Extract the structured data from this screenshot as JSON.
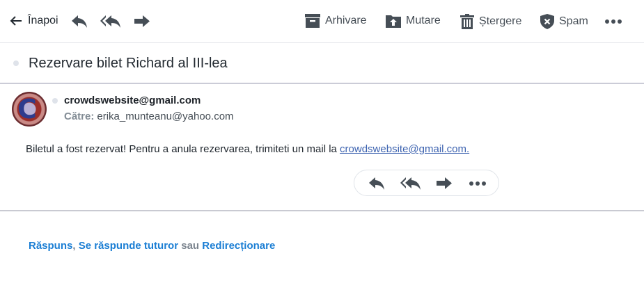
{
  "toolbar": {
    "back_label": "Înapoi",
    "archive_label": "Arhivare",
    "move_label": "Mutare",
    "delete_label": "Ștergere",
    "spam_label": "Spam",
    "icon_color": "#464e56"
  },
  "thread": {
    "subject": "Rezervare bilet Richard al III-lea"
  },
  "message": {
    "sender": "crowdswebsite@gmail.com",
    "to_label": "Către:",
    "to_value": "erika_munteanu@yahoo.com",
    "body_text": "Biletul a fost rezervat! Pentru a anula rezervarea, trimiteti un mail la ",
    "body_link": "crowdswebsite@gmail.com."
  },
  "quick_actions": {
    "reply": "Răspuns",
    "comma": ", ",
    "reply_all": "Se răspunde tuturor",
    "or": " sau ",
    "forward": "Redirecționare",
    "link_color": "#1b7ed4"
  }
}
